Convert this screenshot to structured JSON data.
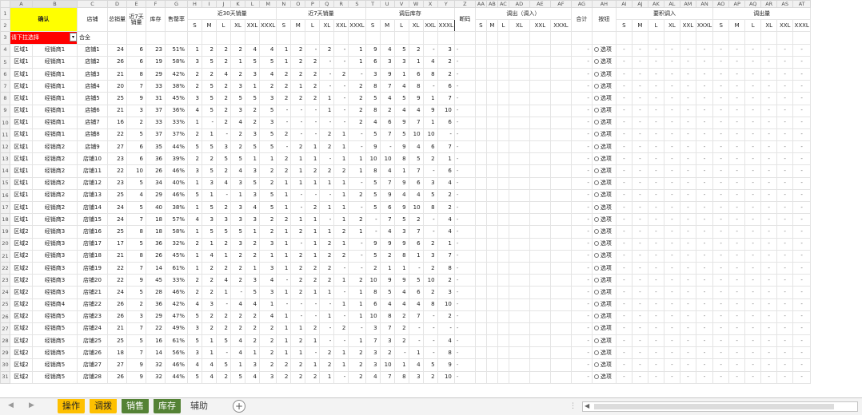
{
  "columns": [
    "",
    "A",
    "B",
    "C",
    "D",
    "E",
    "F",
    "G",
    "H",
    "I",
    "J",
    "K",
    "L",
    "M",
    "N",
    "O",
    "P",
    "Q",
    "R",
    "S",
    "T",
    "U",
    "V",
    "W",
    "X",
    "Y",
    "Z",
    "AA",
    "AB",
    "AC",
    "AD",
    "AE",
    "AF",
    "AG",
    "AH",
    "AI",
    "AJ",
    "AK",
    "AL",
    "AM",
    "AN",
    "AO",
    "AP",
    "AQ",
    "AR",
    "AS",
    "AT"
  ],
  "header": {
    "confirm": "确认",
    "store": "店铺",
    "total_sales": "总销量",
    "sales7": "近7天销量",
    "inventory": "库存",
    "sell_through": "售罄率",
    "sales30_group": "近30天销量",
    "sales7_group": "近7天销量",
    "after_stock_group": "调后库存",
    "broken_size": "断码",
    "transfer_group": "调出（调入）",
    "total": "合计",
    "button": "按钮",
    "need_in_group": "要积调入",
    "out_group": "调出量",
    "filter_value": "请下拉选择",
    "combined": "合全",
    "sizes_a": [
      "S",
      "M",
      "L",
      "XL",
      "XXL",
      "XXXL"
    ],
    "sizes_b": [
      "S",
      "M",
      "L",
      "XL",
      "XXL",
      "XXXL"
    ],
    "sizes_c": [
      "S",
      "M",
      "L",
      "XL",
      "XXL",
      "XXXL"
    ],
    "sizes_d": [
      "S",
      "M",
      "L",
      "XL",
      "XXL",
      "XXXL"
    ],
    "sizes_e": [
      "S",
      "M",
      "L",
      "XL",
      "XXL",
      "XXXL"
    ],
    "sizes_f": [
      "S",
      "M",
      "L",
      "XL",
      "XXL",
      "XXXL"
    ]
  },
  "option_label": "选项",
  "rows": [
    {
      "r": 4,
      "region": "区域1",
      "dealer": "经销商1",
      "store": "店铺1",
      "total": 24,
      "s7": 6,
      "inv": 23,
      "rate": "51%",
      "a": [
        "1",
        "2",
        "2",
        "2",
        "4",
        "4"
      ],
      "b": [
        "1",
        "2",
        "-",
        "2",
        "-",
        "1"
      ],
      "c": [
        "9",
        "4",
        "5",
        "2",
        "-",
        "3"
      ]
    },
    {
      "r": 5,
      "region": "区域1",
      "dealer": "经销商1",
      "store": "店铺2",
      "total": 26,
      "s7": 6,
      "inv": 19,
      "rate": "58%",
      "a": [
        "3",
        "5",
        "2",
        "1",
        "5",
        "5"
      ],
      "b": [
        "1",
        "2",
        "2",
        "-",
        "-",
        "1"
      ],
      "c": [
        "6",
        "3",
        "3",
        "1",
        "4",
        "2"
      ]
    },
    {
      "r": 6,
      "region": "区域1",
      "dealer": "经销商1",
      "store": "店铺3",
      "total": 21,
      "s7": 8,
      "inv": 29,
      "rate": "42%",
      "a": [
        "2",
        "2",
        "4",
        "2",
        "3",
        "4"
      ],
      "b": [
        "2",
        "2",
        "2",
        "-",
        "2",
        "-"
      ],
      "c": [
        "3",
        "9",
        "1",
        "6",
        "8",
        "2"
      ]
    },
    {
      "r": 7,
      "region": "区域1",
      "dealer": "经销商1",
      "store": "店铺4",
      "total": 20,
      "s7": 7,
      "inv": 33,
      "rate": "38%",
      "a": [
        "2",
        "5",
        "2",
        "3",
        "1",
        "2"
      ],
      "b": [
        "2",
        "1",
        "2",
        "-",
        "-",
        "2"
      ],
      "c": [
        "8",
        "7",
        "4",
        "8",
        "-",
        "6"
      ]
    },
    {
      "r": 8,
      "region": "区域1",
      "dealer": "经销商1",
      "store": "店铺5",
      "total": 25,
      "s7": 9,
      "inv": 31,
      "rate": "45%",
      "a": [
        "3",
        "5",
        "2",
        "5",
        "5",
        "3"
      ],
      "b": [
        "2",
        "2",
        "2",
        "1",
        "-",
        "2"
      ],
      "c": [
        "5",
        "4",
        "5",
        "9",
        "1",
        "7"
      ]
    },
    {
      "r": 9,
      "region": "区域1",
      "dealer": "经销商1",
      "store": "店铺6",
      "total": 21,
      "s7": 3,
      "inv": 37,
      "rate": "36%",
      "a": [
        "4",
        "5",
        "2",
        "3",
        "2",
        "5"
      ],
      "b": [
        "-",
        "-",
        "-",
        "1",
        "-",
        "2"
      ],
      "c": [
        "8",
        "2",
        "4",
        "4",
        "9",
        "10"
      ]
    },
    {
      "r": 10,
      "region": "区域1",
      "dealer": "经销商1",
      "store": "店铺7",
      "total": 16,
      "s7": 2,
      "inv": 33,
      "rate": "33%",
      "a": [
        "1",
        "-",
        "2",
        "4",
        "2",
        "3"
      ],
      "b": [
        "-",
        "-",
        "-",
        "-",
        "-",
        "2"
      ],
      "c": [
        "4",
        "6",
        "9",
        "7",
        "1",
        "6"
      ]
    },
    {
      "r": 11,
      "region": "区域1",
      "dealer": "经销商1",
      "store": "店铺8",
      "total": 22,
      "s7": 5,
      "inv": 37,
      "rate": "37%",
      "a": [
        "2",
        "1",
        "-",
        "2",
        "3",
        "5"
      ],
      "b": [
        "2",
        "-",
        "-",
        "2",
        "1",
        "-"
      ],
      "c": [
        "5",
        "7",
        "5",
        "10",
        "10",
        "-"
      ]
    },
    {
      "r": 12,
      "region": "区域1",
      "dealer": "经销商2",
      "store": "店铺9",
      "total": 27,
      "s7": 6,
      "inv": 35,
      "rate": "44%",
      "a": [
        "5",
        "5",
        "3",
        "2",
        "5",
        "5"
      ],
      "b": [
        "-",
        "2",
        "1",
        "2",
        "1",
        "-"
      ],
      "c": [
        "9",
        "-",
        "9",
        "4",
        "6",
        "7"
      ]
    },
    {
      "r": 13,
      "region": "区域1",
      "dealer": "经销商2",
      "store": "店铺10",
      "total": 23,
      "s7": 6,
      "inv": 36,
      "rate": "39%",
      "a": [
        "2",
        "2",
        "5",
        "5",
        "1",
        "1"
      ],
      "b": [
        "2",
        "1",
        "1",
        "-",
        "1",
        "1"
      ],
      "c": [
        "10",
        "10",
        "8",
        "5",
        "2",
        "1"
      ]
    },
    {
      "r": 14,
      "region": "区域1",
      "dealer": "经销商2",
      "store": "店铺11",
      "total": 22,
      "s7": 10,
      "inv": 26,
      "rate": "46%",
      "a": [
        "3",
        "5",
        "2",
        "4",
        "3",
        "2"
      ],
      "b": [
        "2",
        "1",
        "2",
        "2",
        "2",
        "1"
      ],
      "c": [
        "8",
        "4",
        "1",
        "7",
        "-",
        "6"
      ]
    },
    {
      "r": 15,
      "region": "区域1",
      "dealer": "经销商2",
      "store": "店铺12",
      "total": 23,
      "s7": 5,
      "inv": 34,
      "rate": "40%",
      "a": [
        "1",
        "3",
        "4",
        "3",
        "5",
        "2"
      ],
      "b": [
        "1",
        "1",
        "1",
        "1",
        "1",
        "-"
      ],
      "c": [
        "5",
        "7",
        "9",
        "6",
        "3",
        "4"
      ]
    },
    {
      "r": 16,
      "region": "区域1",
      "dealer": "经销商2",
      "store": "店铺13",
      "total": 25,
      "s7": 4,
      "inv": 29,
      "rate": "46%",
      "a": [
        "5",
        "1",
        "-",
        "1",
        "3",
        "5"
      ],
      "b": [
        "1",
        "-",
        "-",
        "-",
        "1",
        "2"
      ],
      "c": [
        "5",
        "9",
        "4",
        "4",
        "5",
        "2"
      ]
    },
    {
      "r": 17,
      "region": "区域1",
      "dealer": "经销商2",
      "store": "店铺14",
      "total": 24,
      "s7": 5,
      "inv": 40,
      "rate": "38%",
      "a": [
        "1",
        "5",
        "2",
        "3",
        "4",
        "5"
      ],
      "b": [
        "1",
        "-",
        "2",
        "1",
        "1",
        "-"
      ],
      "c": [
        "5",
        "6",
        "9",
        "10",
        "8",
        "2"
      ]
    },
    {
      "r": 18,
      "region": "区域1",
      "dealer": "经销商2",
      "store": "店铺15",
      "total": 24,
      "s7": 7,
      "inv": 18,
      "rate": "57%",
      "a": [
        "4",
        "3",
        "3",
        "3",
        "3",
        "2"
      ],
      "b": [
        "2",
        "1",
        "1",
        "-",
        "1",
        "2"
      ],
      "c": [
        "-",
        "7",
        "5",
        "2",
        "-",
        "4"
      ]
    },
    {
      "r": 19,
      "region": "区域2",
      "dealer": "经销商3",
      "store": "店铺16",
      "total": 25,
      "s7": 8,
      "inv": 18,
      "rate": "58%",
      "a": [
        "1",
        "5",
        "5",
        "5",
        "1",
        "2"
      ],
      "b": [
        "1",
        "2",
        "1",
        "1",
        "2",
        "1"
      ],
      "c": [
        "-",
        "4",
        "3",
        "7",
        "-",
        "4"
      ]
    },
    {
      "r": 20,
      "region": "区域2",
      "dealer": "经销商3",
      "store": "店铺17",
      "total": 17,
      "s7": 5,
      "inv": 36,
      "rate": "32%",
      "a": [
        "2",
        "1",
        "2",
        "3",
        "2",
        "3"
      ],
      "b": [
        "1",
        "-",
        "1",
        "2",
        "1",
        "-"
      ],
      "c": [
        "9",
        "9",
        "9",
        "6",
        "2",
        "1"
      ]
    },
    {
      "r": 21,
      "region": "区域2",
      "dealer": "经销商3",
      "store": "店铺18",
      "total": 21,
      "s7": 8,
      "inv": 26,
      "rate": "45%",
      "a": [
        "1",
        "4",
        "1",
        "2",
        "2",
        "1"
      ],
      "b": [
        "1",
        "2",
        "1",
        "2",
        "2",
        "-"
      ],
      "c": [
        "5",
        "2",
        "8",
        "1",
        "3",
        "7"
      ]
    },
    {
      "r": 22,
      "region": "区域2",
      "dealer": "经销商3",
      "store": "店铺19",
      "total": 22,
      "s7": 7,
      "inv": 14,
      "rate": "61%",
      "a": [
        "1",
        "2",
        "2",
        "2",
        "1",
        "3"
      ],
      "b": [
        "1",
        "2",
        "2",
        "2",
        "-",
        "-"
      ],
      "c": [
        "2",
        "1",
        "1",
        "-",
        "2",
        "8"
      ]
    },
    {
      "r": 23,
      "region": "区域2",
      "dealer": "经销商3",
      "store": "店铺20",
      "total": 22,
      "s7": 9,
      "inv": 45,
      "rate": "33%",
      "a": [
        "2",
        "2",
        "4",
        "2",
        "3",
        "4"
      ],
      "b": [
        "-",
        "2",
        "2",
        "2",
        "1",
        "2"
      ],
      "c": [
        "10",
        "9",
        "9",
        "5",
        "10",
        "2"
      ]
    },
    {
      "r": 24,
      "region": "区域2",
      "dealer": "经销商3",
      "store": "店铺21",
      "total": 24,
      "s7": 5,
      "inv": 28,
      "rate": "46%",
      "a": [
        "2",
        "2",
        "1",
        "-",
        "5",
        "3"
      ],
      "b": [
        "1",
        "2",
        "1",
        "1",
        "-",
        "1"
      ],
      "c": [
        "8",
        "5",
        "4",
        "6",
        "2",
        "3"
      ]
    },
    {
      "r": 25,
      "region": "区域2",
      "dealer": "经销商4",
      "store": "店铺22",
      "total": 26,
      "s7": 2,
      "inv": 36,
      "rate": "42%",
      "a": [
        "4",
        "3",
        "-",
        "4",
        "4",
        "1"
      ],
      "b": [
        "-",
        "-",
        "-",
        "-",
        "1",
        "1"
      ],
      "c": [
        "6",
        "4",
        "4",
        "4",
        "8",
        "10"
      ]
    },
    {
      "r": 26,
      "region": "区域2",
      "dealer": "经销商5",
      "store": "店铺23",
      "total": 26,
      "s7": 3,
      "inv": 29,
      "rate": "47%",
      "a": [
        "5",
        "2",
        "2",
        "2",
        "2",
        "4"
      ],
      "b": [
        "1",
        "-",
        "-",
        "1",
        "-",
        "1"
      ],
      "c": [
        "10",
        "8",
        "2",
        "7",
        "-",
        "2"
      ]
    },
    {
      "r": 27,
      "region": "区域2",
      "dealer": "经销商5",
      "store": "店铺24",
      "total": 21,
      "s7": 7,
      "inv": 22,
      "rate": "49%",
      "a": [
        "3",
        "2",
        "2",
        "2",
        "2",
        "2"
      ],
      "b": [
        "1",
        "1",
        "2",
        "-",
        "2",
        "-"
      ],
      "c": [
        "3",
        "7",
        "2",
        "-",
        "-",
        "-"
      ]
    },
    {
      "r": 28,
      "region": "区域2",
      "dealer": "经销商5",
      "store": "店铺25",
      "total": 25,
      "s7": 5,
      "inv": 16,
      "rate": "61%",
      "a": [
        "5",
        "1",
        "5",
        "4",
        "2",
        "2"
      ],
      "b": [
        "1",
        "2",
        "1",
        "-",
        "-",
        "1"
      ],
      "c": [
        "7",
        "3",
        "2",
        "-",
        "-",
        "4"
      ]
    },
    {
      "r": 29,
      "region": "区域2",
      "dealer": "经销商5",
      "store": "店铺26",
      "total": 18,
      "s7": 7,
      "inv": 14,
      "rate": "56%",
      "a": [
        "3",
        "1",
        "-",
        "4",
        "1",
        "2"
      ],
      "b": [
        "1",
        "1",
        "-",
        "2",
        "1",
        "2"
      ],
      "c": [
        "3",
        "2",
        "-",
        "1",
        "-",
        "8"
      ]
    },
    {
      "r": 30,
      "region": "区域2",
      "dealer": "经销商5",
      "store": "店铺27",
      "total": 27,
      "s7": 9,
      "inv": 32,
      "rate": "46%",
      "a": [
        "4",
        "4",
        "5",
        "1",
        "3",
        "2"
      ],
      "b": [
        "2",
        "2",
        "1",
        "2",
        "1",
        "2"
      ],
      "c": [
        "3",
        "10",
        "1",
        "4",
        "5",
        "9"
      ]
    },
    {
      "r": 31,
      "region": "区域2",
      "dealer": "经销商5",
      "store": "店铺28",
      "total": 26,
      "s7": 9,
      "inv": 32,
      "rate": "44%",
      "a": [
        "5",
        "4",
        "2",
        "5",
        "4",
        "3"
      ],
      "b": [
        "2",
        "2",
        "2",
        "1",
        "-",
        "2"
      ],
      "c": [
        "4",
        "7",
        "8",
        "3",
        "2",
        "10"
      ]
    }
  ],
  "tabs": {
    "t1": "操作",
    "t2": "调拨",
    "t3": "销售",
    "t4": "库存",
    "t5": "辅助",
    "c1": "#fec000",
    "c2": "#fec000",
    "c3": "#548235",
    "c4": "#548235"
  }
}
